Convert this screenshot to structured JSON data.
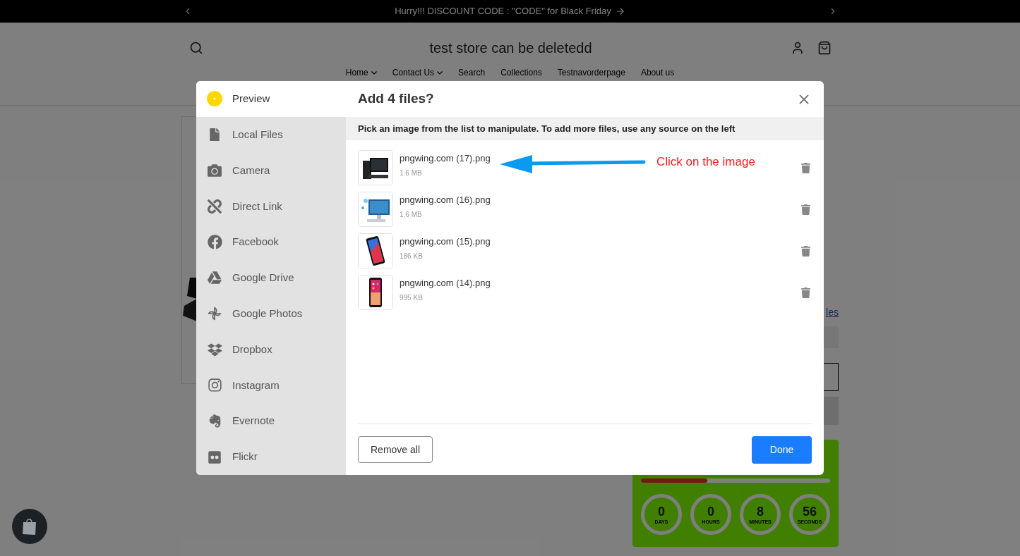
{
  "announcement": {
    "text": "Hurry!!! DISCOUNT CODE : \"CODE\" for Black Friday"
  },
  "store": {
    "title": "test store can be deletedd",
    "nav": [
      {
        "label": "Home",
        "dropdown": true
      },
      {
        "label": "Contact Us",
        "dropdown": true
      },
      {
        "label": "Search",
        "dropdown": false
      },
      {
        "label": "Collections",
        "dropdown": false
      },
      {
        "label": "Testnavorderpage",
        "dropdown": false
      },
      {
        "label": "About us",
        "dropdown": false
      }
    ]
  },
  "page": {
    "link_fragment": "les",
    "countdown": {
      "level": 0.35,
      "units": [
        {
          "value": "0",
          "label": "DAYS"
        },
        {
          "value": "0",
          "label": "HOURS"
        },
        {
          "value": "8",
          "label": "MINUTES"
        },
        {
          "value": "56",
          "label": "SECONDS"
        }
      ]
    }
  },
  "dialog": {
    "sidebar": [
      {
        "label": "Preview",
        "selected": true
      },
      {
        "label": "Local Files",
        "selected": false
      },
      {
        "label": "Camera",
        "selected": false
      },
      {
        "label": "Direct Link",
        "selected": false
      },
      {
        "label": "Facebook",
        "selected": false
      },
      {
        "label": "Google Drive",
        "selected": false
      },
      {
        "label": "Google Photos",
        "selected": false
      },
      {
        "label": "Dropbox",
        "selected": false
      },
      {
        "label": "Instagram",
        "selected": false
      },
      {
        "label": "Evernote",
        "selected": false
      },
      {
        "label": "Flickr",
        "selected": false
      }
    ],
    "title": "Add 4 files?",
    "instructions": "Pick an image from the list to manipulate. To add more files, use any source on the left",
    "files": [
      {
        "name": "pngwing.com (17).png",
        "size": "1.6 MB"
      },
      {
        "name": "pngwing.com (16).png",
        "size": "1.6 MB"
      },
      {
        "name": "pngwing.com (15).png",
        "size": "186 KB"
      },
      {
        "name": "pngwing.com (14).png",
        "size": "995 KB"
      }
    ],
    "annotation": "Click on the image",
    "remove_all": "Remove all",
    "done": "Done"
  }
}
